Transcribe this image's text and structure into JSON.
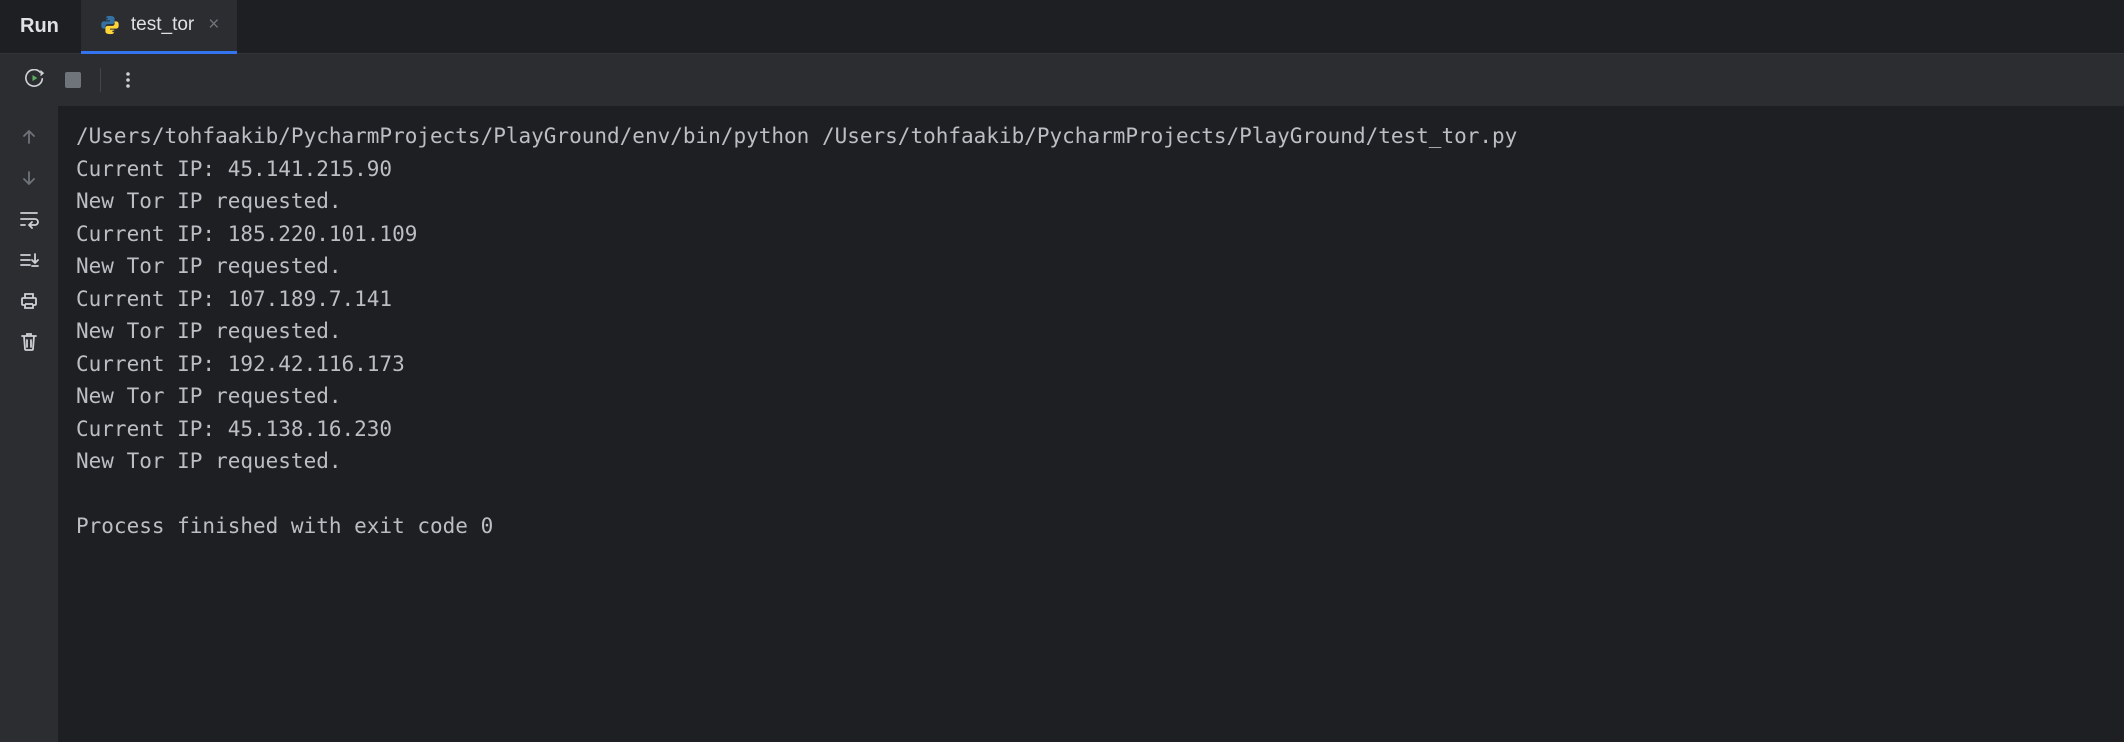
{
  "header": {
    "run_label": "Run",
    "tab_label": "test_tor"
  },
  "console": {
    "lines": [
      "/Users/tohfaakib/PycharmProjects/PlayGround/env/bin/python /Users/tohfaakib/PycharmProjects/PlayGround/test_tor.py",
      "Current IP: 45.141.215.90",
      "New Tor IP requested.",
      "Current IP: 185.220.101.109",
      "New Tor IP requested.",
      "Current IP: 107.189.7.141",
      "New Tor IP requested.",
      "Current IP: 192.42.116.173",
      "New Tor IP requested.",
      "Current IP: 45.138.16.230",
      "New Tor IP requested.",
      "",
      "Process finished with exit code 0"
    ]
  }
}
